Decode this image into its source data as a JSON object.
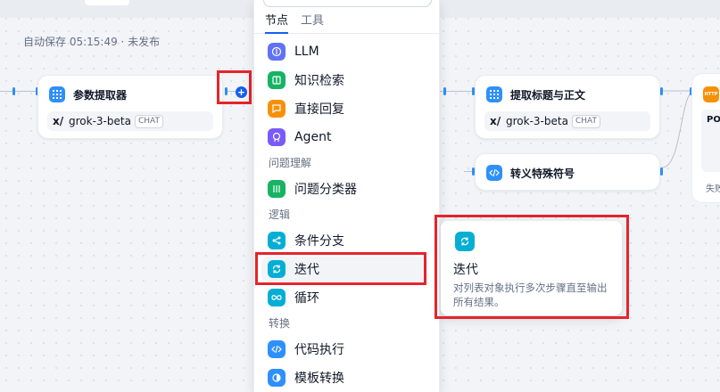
{
  "autosave_text": "自动保存 05:15:49 · 未发布",
  "nodes": {
    "param_extractor": {
      "title": "参数提取器",
      "model": "grok-3-beta",
      "model_mode": "CHAT"
    },
    "extract_title": {
      "title": "提取标题与正文",
      "model": "grok-3-beta",
      "model_mode": "CHAT"
    },
    "escape_chars": {
      "title": "转义特殊符号"
    },
    "http": {
      "badge": "HTTP",
      "method": "PO",
      "status": "失败"
    }
  },
  "colors": {
    "accent": "#155eef",
    "highlight_red": "#e5242b",
    "llm": "#6172f3",
    "knowledge": "#16b364",
    "answer": "#f79009",
    "agent": "#7a5af8",
    "classifier": "#16b364",
    "logic": "#06aed4",
    "code": "#2e90fa"
  },
  "picker": {
    "tabs": [
      {
        "label": "节点",
        "active": true
      },
      {
        "label": "工具",
        "active": false
      }
    ],
    "items": [
      {
        "label": "LLM",
        "icon": "llm-icon"
      },
      {
        "label": "知识检索",
        "icon": "book-icon"
      },
      {
        "label": "直接回复",
        "icon": "reply-icon"
      },
      {
        "label": "Agent",
        "icon": "agent-icon"
      },
      {
        "label": "问题分类器",
        "icon": "classifier-icon"
      },
      {
        "label": "条件分支",
        "icon": "branch-icon"
      },
      {
        "label": "迭代",
        "icon": "iteration-icon"
      },
      {
        "label": "循环",
        "icon": "loop-icon"
      },
      {
        "label": "代码执行",
        "icon": "code-icon"
      },
      {
        "label": "模板转换",
        "icon": "template-icon"
      }
    ],
    "groups": {
      "question_understanding": "问题理解",
      "logic": "逻辑",
      "transform": "转换"
    }
  },
  "tooltip": {
    "title": "迭代",
    "description": "对列表对象执行多次步骤直至输出所有结果。"
  }
}
